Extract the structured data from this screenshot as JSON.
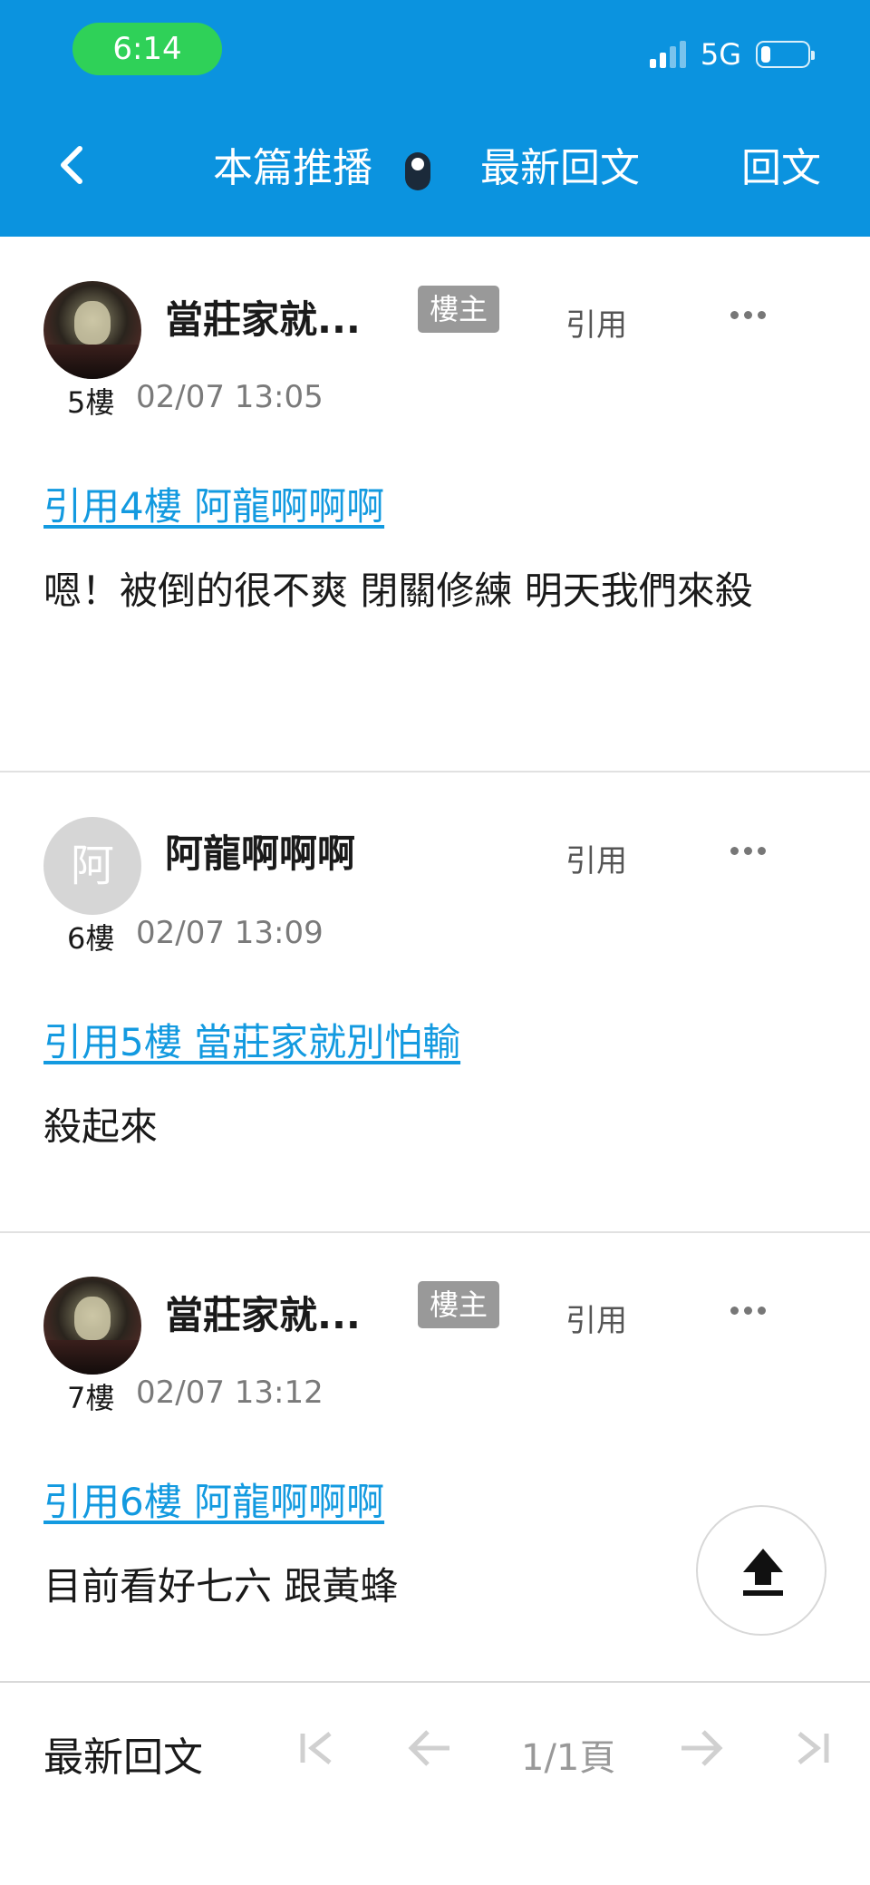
{
  "status_bar": {
    "time": "6:14",
    "network": "5G"
  },
  "nav": {
    "recommend": "本篇推播",
    "latest": "最新回文",
    "reply": "回文"
  },
  "posts": [
    {
      "username": "當莊家就...",
      "badge": "樓主",
      "quote_label": "引用",
      "floor": "5樓",
      "time": "02/07 13:05",
      "quote_link": "引用4樓 阿龍啊啊啊",
      "content": "嗯！被倒的很不爽 閉關修練 明天我們來殺"
    },
    {
      "username": "阿龍啊啊啊",
      "avatar_text": "阿",
      "quote_label": "引用",
      "floor": "6樓",
      "time": "02/07 13:09",
      "quote_link": "引用5樓 當莊家就別怕輸",
      "content": "殺起來"
    },
    {
      "username": "當莊家就...",
      "badge": "樓主",
      "quote_label": "引用",
      "floor": "7樓",
      "time": "02/07 13:12",
      "quote_link": "引用6樓 阿龍啊啊啊",
      "content": "目前看好七六 跟黃蜂"
    }
  ],
  "bottom_bar": {
    "label": "最新回文",
    "page": "1/1頁"
  },
  "colors": {
    "header": "#0b93df",
    "link": "#139ae0",
    "time_pill": "#2fd158"
  }
}
